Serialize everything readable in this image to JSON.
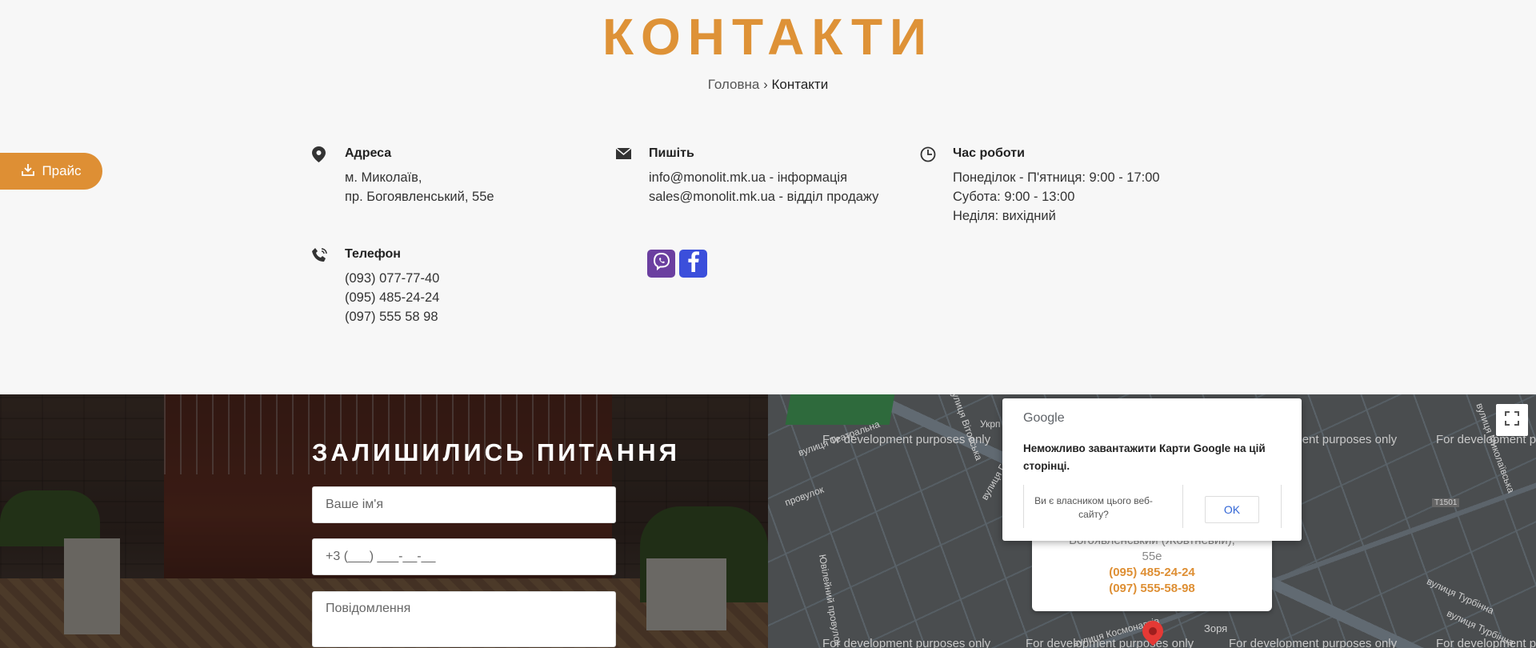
{
  "page": {
    "title": "КОНТАКТИ",
    "breadcrumb": {
      "home": "Головна",
      "separator": " › ",
      "current": "Контакти"
    }
  },
  "contacts": {
    "address": {
      "title": "Адреса",
      "lines": [
        "м. Миколаїв,",
        "пр. Богоявленський, 55е"
      ],
      "icon": "location-pin-icon"
    },
    "write": {
      "title": "Пишіть",
      "lines": [
        "info@monolit.mk.ua - інформація",
        "sales@monolit.mk.ua - відділ продажу"
      ],
      "icon": "envelope-icon"
    },
    "hours": {
      "title": "Час роботи",
      "lines": [
        "Понеділок - П'ятниця: 9:00 - 17:00",
        "Субота: 9:00 - 13:00",
        "Неділя: вихідний"
      ],
      "icon": "clock-icon"
    },
    "phone": {
      "title": "Телефон",
      "lines": [
        "(093) 077-77-40",
        "(095) 485-24-24",
        "(097) 555 58 98"
      ],
      "icon": "phone-icon"
    }
  },
  "social": {
    "viber": "viber-icon",
    "facebook": "facebook-icon"
  },
  "form": {
    "title": "ЗАЛИШИЛИСЬ ПИТАННЯ",
    "name_placeholder": "Ваше ім'я",
    "phone_placeholder": "+3 (___) ___-__-__",
    "message_placeholder": "Повідомлення"
  },
  "price_button": {
    "label": "Прайс",
    "icon": "download-icon"
  },
  "map": {
    "dev_text": "For development purposes only",
    "streets": [
      "вулиця Театральна",
      "вулиця Вітовська",
      "вулиця Гоголя",
      "Укрп",
      "вулиця Миколаївська",
      "вулиця Космонавтів",
      "вулиця Турбінна",
      "Ювілейний провулок",
      "провулок",
      "вулиця Турбінна"
    ],
    "road_badge": "T1501",
    "poi": "Зоря",
    "info_window": {
      "address_line1": "Богоявленський (Жовтневий),",
      "address_line2": "55е",
      "phone1": "(095) 485-24-24",
      "phone2": "(097) 555-58-98"
    },
    "dialog": {
      "logo": "Google",
      "message": "Неможливо завантажити Карти Google на цій сторінці.",
      "question": "Ви є власником цього веб-сайту?",
      "ok": "OK"
    }
  },
  "colors": {
    "accent": "#de9237",
    "viber": "#6b3fa0",
    "facebook": "#3b4fdb"
  }
}
